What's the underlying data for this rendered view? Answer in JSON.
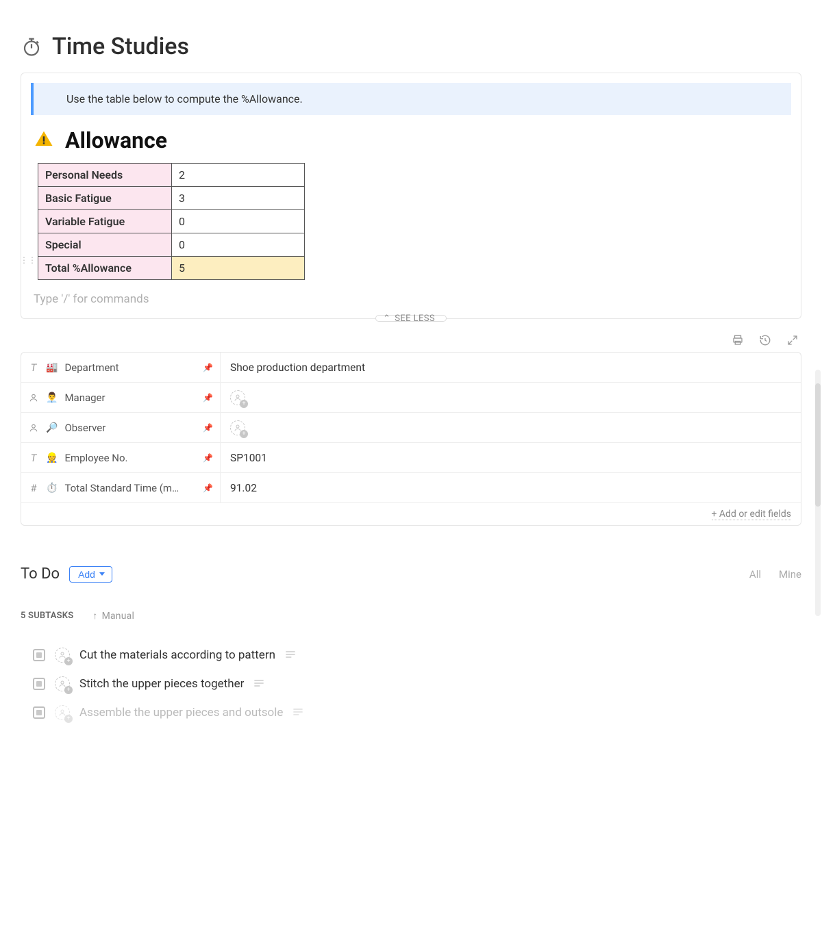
{
  "header": {
    "title": "Time Studies"
  },
  "callout": {
    "text": "Use the table below to compute the %Allowance."
  },
  "allowance": {
    "heading": "Allowance",
    "rows": [
      {
        "label": "Personal Needs",
        "value": "2"
      },
      {
        "label": "Basic Fatigue",
        "value": "3"
      },
      {
        "label": "Variable Fatigue",
        "value": "0"
      },
      {
        "label": "Special",
        "value": "0"
      }
    ],
    "total": {
      "label": "Total %Allowance",
      "value": "5"
    }
  },
  "slash_placeholder": "Type '/' for commands",
  "see_less": "SEE LESS",
  "fields": [
    {
      "type": "T",
      "emoji": "🏭",
      "label": "Department",
      "value": "Shoe production department",
      "kind": "text"
    },
    {
      "type": "person",
      "emoji": "👨‍💼",
      "label": "Manager",
      "value": "",
      "kind": "person"
    },
    {
      "type": "person",
      "emoji": "🔎",
      "label": "Observer",
      "value": "",
      "kind": "person"
    },
    {
      "type": "T",
      "emoji": "👷",
      "label": "Employee No.",
      "value": "SP1001",
      "kind": "text"
    },
    {
      "type": "#",
      "emoji": "⏱️",
      "label": "Total Standard Time (mi…",
      "value": "91.02",
      "kind": "text"
    }
  ],
  "add_fields": "+ Add or edit fields",
  "todo": {
    "title": "To Do",
    "add": "Add",
    "filters": {
      "all": "All",
      "mine": "Mine"
    },
    "count_label": "5 SUBTASKS",
    "sort": "Manual",
    "items": [
      "Cut the materials according to pattern",
      "Stitch the upper pieces together",
      "Assemble the upper pieces and outsole"
    ]
  }
}
